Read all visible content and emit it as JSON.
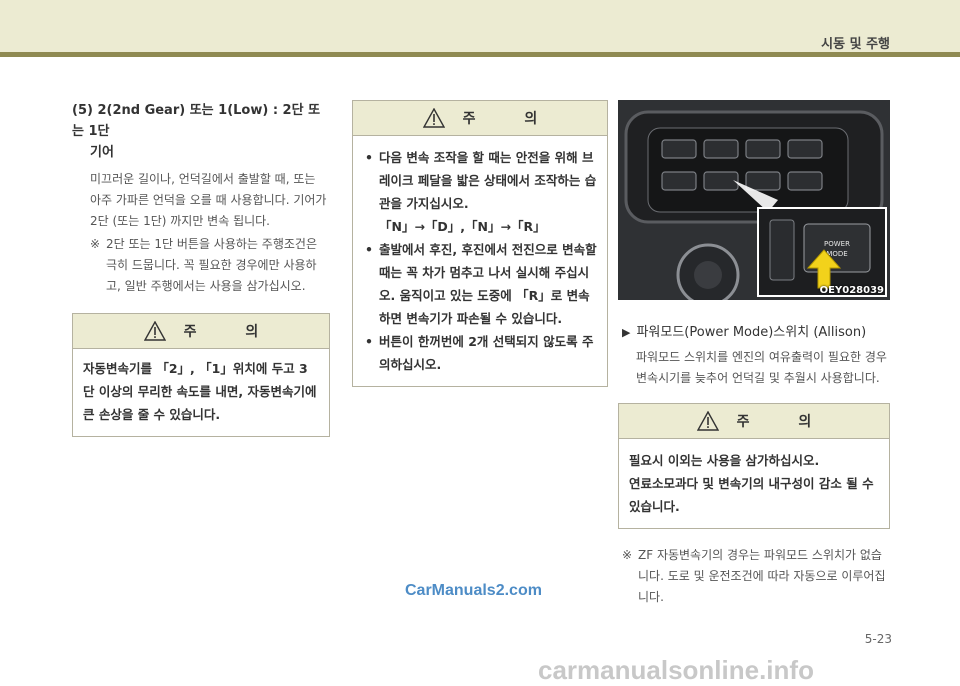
{
  "header": {
    "title": "시동 및 주행"
  },
  "left": {
    "title_line1": "(5) 2(2nd Gear) 또는 1(Low) :  2단 또는 1단",
    "title_line2": "기어",
    "para": "미끄러운 길이나, 언덕길에서 출발할 때, 또는 아주 가파른 언덕을 오를 때 사용합니다. 기어가 2단 (또는 1단) 까지만 변속 됩니다.",
    "note_mark": "※",
    "note": "2단 또는 1단 버튼을 사용하는 주행조건은 극히 드뭅니다. 꼭 필요한 경우에만 사용하고, 일반 주행에서는 사용을 삼가십시오.",
    "caution": {
      "heading": "주 의",
      "body": "자동변속기를 「2」, 「1」위치에 두고 3단 이상의 무리한 속도를 내면, 자동변속기에 큰 손상을 줄 수 있습니다."
    }
  },
  "middle": {
    "caution": {
      "heading": "주 의",
      "items": [
        "다음 변속 조작을 할 때는 안전을 위해 브레이크 페달을 밟은 상태에서 조작하는 습관을 가지십시오.",
        "출발에서 후진, 후진에서 전진으로 변속할 때는 꼭 차가 멈추고 나서 실시해 주십시오. 움직이고 있는 도중에 「R」로 변속하면 변속기가 파손될 수 있습니다.",
        "버튼이 한꺼번에 2개 선택되지 않도록 주의하십시오."
      ],
      "sequence": "「N」→「D」,「N」→「R」"
    }
  },
  "right": {
    "photo_label": "OEY028039",
    "photo_button_label_1": "POWER",
    "photo_button_label_2": "MODE",
    "subsection_marker": "▶",
    "subsection_title": "파워모드(Power Mode)스위치 (Allison)",
    "para": "파워모드 스위치를 엔진의 여유출력이 필요한 경우 변속시기를 늦추어 언덕길 및 추월시 사용합니다.",
    "caution": {
      "heading": "주 의",
      "line1": "필요시 이외는 사용을 삼가하십시오.",
      "line2": "연료소모과다 및 변속기의 내구성이 감소 될 수 있습니다."
    },
    "note_mark": "※",
    "note": "ZF 자동변속기의 경우는 파워모드 스위치가 없습니다. 도로 및 운전조건에 따라 자동으로 이루어집니다."
  },
  "page_number": "5-23",
  "watermark_site": "CarManuals2.com",
  "footer_watermark": "carmanualsonline.info"
}
